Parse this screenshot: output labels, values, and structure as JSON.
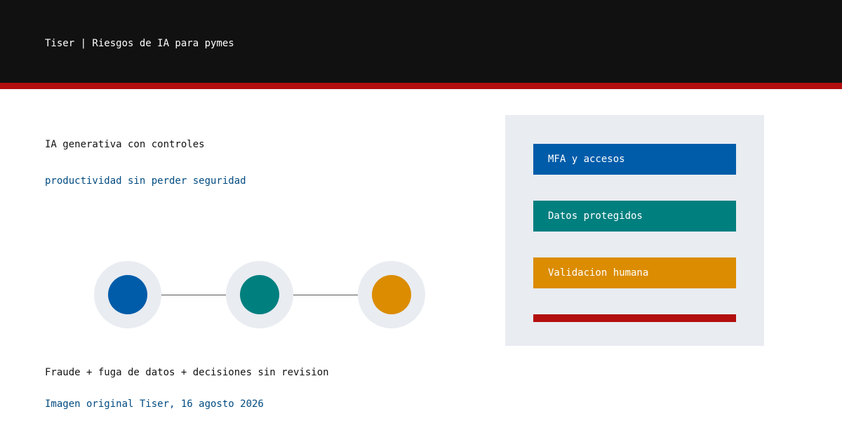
{
  "header": {
    "title": "Tiser | Riesgos de IA para pymes"
  },
  "main": {
    "heading": "IA generativa con controles",
    "subheading": "productividad sin perder seguridad",
    "risks": "Fraude + fuga de datos + decisiones sin revision",
    "credit": "Imagen original Tiser, 16 agosto 2026"
  },
  "controls": [
    {
      "label": "MFA y accesos",
      "color": "#005ca9"
    },
    {
      "label": "Datos protegidos",
      "color": "#007f7f"
    },
    {
      "label": "Validacion humana",
      "color": "#db8c00"
    }
  ],
  "colors": {
    "header_bg": "#111111",
    "accent_red": "#b30f0f",
    "link_blue": "#004a80",
    "panel_bg": "#e9ecf1",
    "ring_bg": "#e9ecf1",
    "node_1": "#005ca9",
    "node_2": "#007f7f",
    "node_3": "#db8c00"
  }
}
